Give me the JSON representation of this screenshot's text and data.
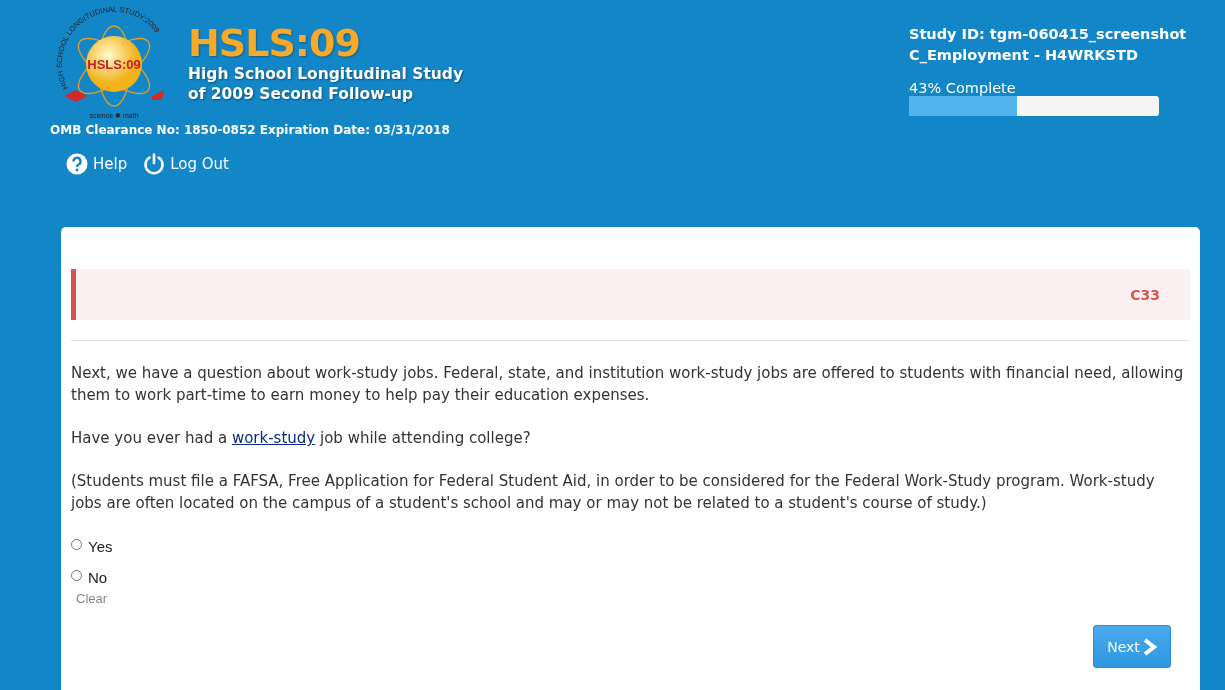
{
  "logo": {
    "center_text": "HSLS:09",
    "ring_text": "HIGH SCHOOL LONGITUDINAL STUDY:2009",
    "bottom_text": "science ✱ math"
  },
  "brand": {
    "title": "HSLS:09",
    "subtitle_lines": [
      "High School Longitudinal Study",
      "of 2009 Second Follow-up"
    ],
    "clearance": "OMB Clearance No: 1850-0852 Expiration Date: 03/31/2018"
  },
  "nav": [
    {
      "kind": "help",
      "label": "Help"
    },
    {
      "kind": "logout",
      "label": "Log Out"
    }
  ],
  "study": {
    "id_line": "Study ID: tgm-060415_screenshot",
    "section_line": "C_Employment - H4WRKSTD"
  },
  "progress": {
    "label": "43% Complete",
    "level": 0.43
  },
  "question": {
    "code": "C33",
    "paragraphs": [
      "Next, we have a question about work-study jobs. Federal, state, and institution work-study jobs are offered to students with financial need, allowing them to work part-time to earn money to help pay their education expenses.",
      {
        "before": "Have you ever had a ",
        "link": "work-study",
        "after": " job while attending college?"
      },
      "(Students must file a FAFSA, Free Application for Federal Student Aid, in order to be considered for the Federal Work-Study program. Work-study jobs are often located on the campus of a student's school and may or may not be related to a student's course of study.)"
    ],
    "options": [
      {
        "label": "Yes",
        "selected": false
      },
      {
        "label": "No",
        "selected": false
      }
    ],
    "clear": "Clear"
  },
  "next_button": "Next"
}
